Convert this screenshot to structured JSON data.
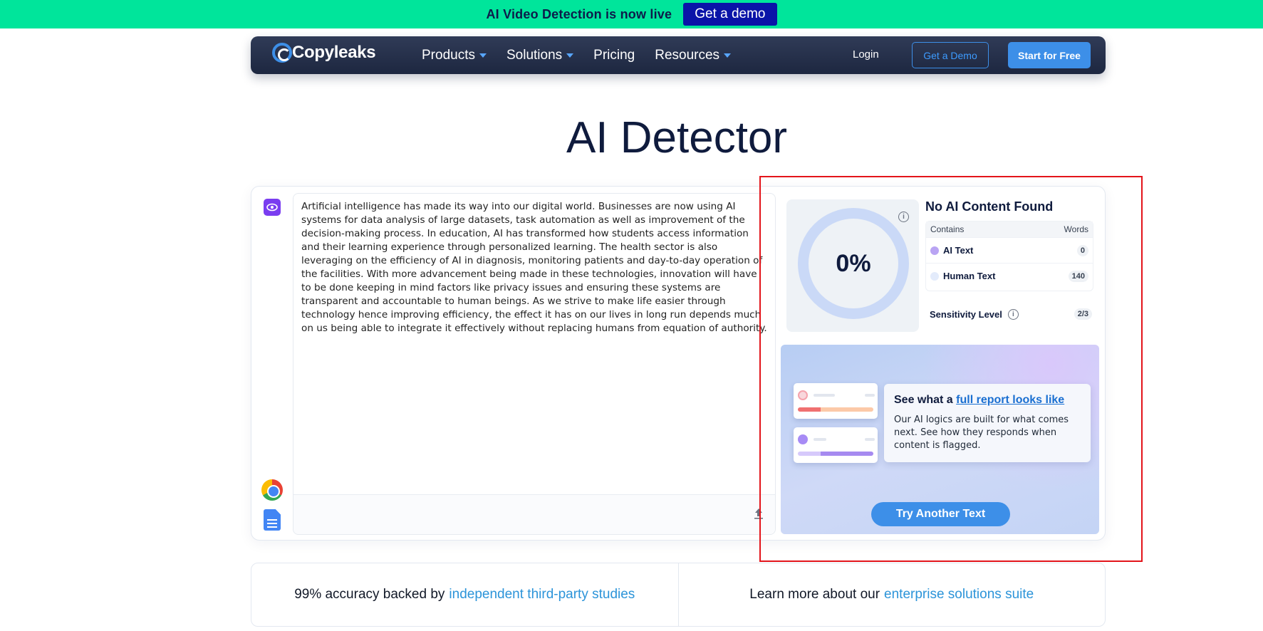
{
  "banner": {
    "text": "AI Video Detection is now live",
    "button": "Get a demo"
  },
  "nav": {
    "logo": "Copyleaks",
    "links": [
      "Products",
      "Solutions",
      "Pricing",
      "Resources"
    ],
    "login": "Login",
    "demo": "Get a Demo",
    "start": "Start for Free"
  },
  "page": {
    "title": "AI Detector"
  },
  "input": {
    "text": "Artificial intelligence has made its way into our digital world. Businesses are now using AI systems for data analysis of large datasets, task automation as well as improvement of the decision-making process. In education, AI has transformed how students access information and their learning experience through personalized learning. The health sector is also leveraging on the efficiency of AI in diagnosis, monitoring patients and day-to-day operation of the facilities. With more advancement being made in these technologies, innovation will have to be done keeping in mind factors like privacy issues and ensuring these systems are transparent and accountable to human beings. As we strive to make life easier through technology hence improving efficiency, the effect it has on our lives in long run depends much on us being able to integrate it effectively without replacing humans from equation of authority."
  },
  "result": {
    "score": "0%",
    "title": "No AI Content Found",
    "table": {
      "header_contains": "Contains",
      "header_words": "Words",
      "rows": [
        {
          "label": "AI Text",
          "count": "0",
          "color": "#b9a4f3"
        },
        {
          "label": "Human Text",
          "count": "140",
          "color": "#e3ebfb"
        }
      ]
    },
    "sensitivity": {
      "label": "Sensitivity Level",
      "value": "2/3"
    }
  },
  "promo": {
    "head_prefix": "See what a",
    "head_link": "full report looks like",
    "desc": "Our AI logics are built for what comes next. See how they responds when content is flagged.",
    "button": "Try Another Text"
  },
  "info": {
    "left_text": "99% accuracy backed by",
    "left_link": "independent third-party studies",
    "right_text": "Learn more about our",
    "right_link": "enterprise solutions suite"
  },
  "colors": {
    "banner": "#00e59b",
    "accent": "#3d8fe8",
    "highlight": "#e3141a"
  }
}
